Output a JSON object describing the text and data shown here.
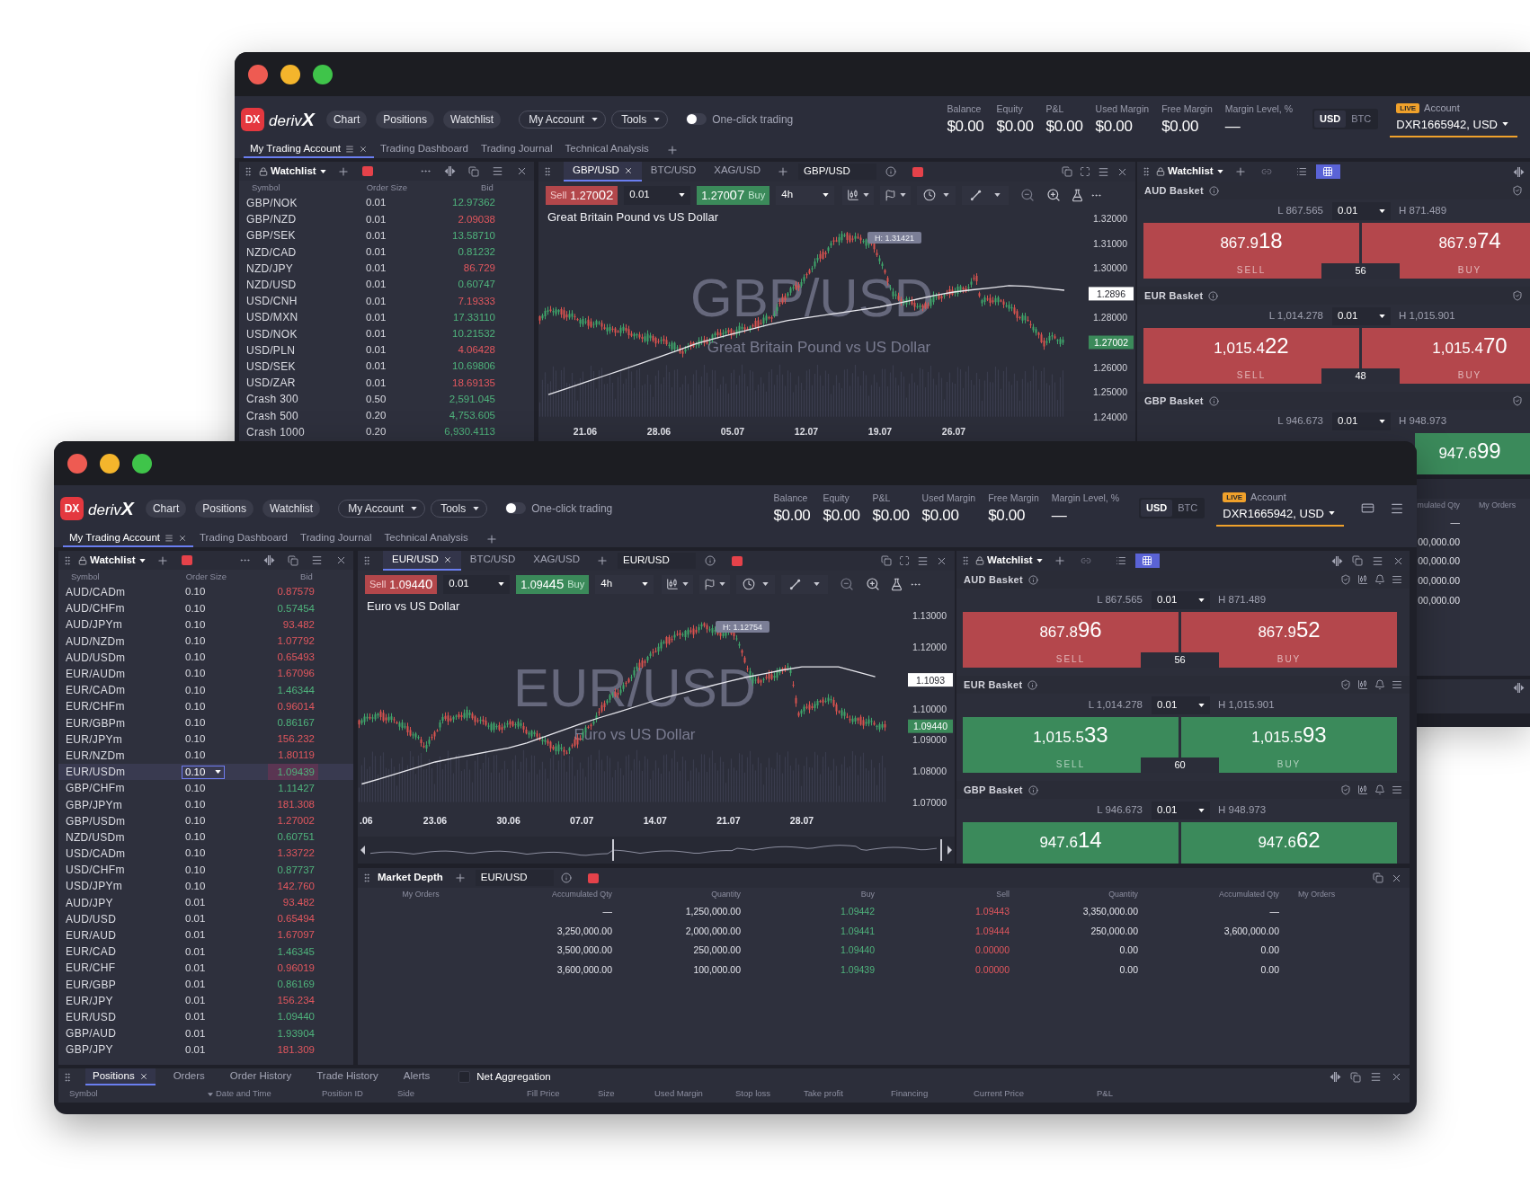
{
  "back_window": {
    "logo": {
      "badge": "DX",
      "wordmark": "deriv**X**"
    },
    "nav": [
      "Chart",
      "Positions",
      "Watchlist"
    ],
    "menus": [
      "My Account",
      "Tools"
    ],
    "one_click_trading": {
      "label": "One-click trading",
      "on": false
    },
    "metrics": [
      {
        "label": "Balance",
        "value": "$0.00"
      },
      {
        "label": "Equity",
        "value": "$0.00"
      },
      {
        "label": "P&L",
        "value": "$0.00"
      },
      {
        "label": "Used Margin",
        "value": "$0.00"
      },
      {
        "label": "Free Margin",
        "value": "$0.00"
      },
      {
        "label": "Margin Level, %",
        "value": "—"
      }
    ],
    "currencies": [
      {
        "label": "USD",
        "selected": true
      },
      {
        "label": "BTC",
        "selected": false
      }
    ],
    "account": {
      "badge": "LIVE",
      "label": "Account",
      "value": "DXR1665942, USD"
    },
    "workspace_tabs": [
      {
        "label": "My Trading Account",
        "selected": true
      },
      {
        "label": "Trading Dashboard",
        "selected": false
      },
      {
        "label": "Trading Journal",
        "selected": false
      },
      {
        "label": "Technical Analysis",
        "selected": false
      }
    ],
    "watchlist": {
      "title": "Watchlist",
      "columns": [
        "Symbol",
        "Order Size",
        "Bid"
      ],
      "rows": [
        {
          "symbol": "GBP/NOK",
          "order_size": "0.01",
          "bid": "12.97362",
          "rising": true,
          "selected": false
        },
        {
          "symbol": "GBP/NZD",
          "order_size": "0.01",
          "bid": "2.09038",
          "rising": false,
          "selected": false
        },
        {
          "symbol": "GBP/SEK",
          "order_size": "0.01",
          "bid": "13.58710",
          "rising": true,
          "selected": false
        },
        {
          "symbol": "NZD/CAD",
          "order_size": "0.01",
          "bid": "0.81232",
          "rising": true,
          "selected": false
        },
        {
          "symbol": "NZD/JPY",
          "order_size": "0.01",
          "bid": "86.729",
          "rising": false,
          "selected": false
        },
        {
          "symbol": "NZD/USD",
          "order_size": "0.01",
          "bid": "0.60747",
          "rising": true,
          "selected": false
        },
        {
          "symbol": "USD/CNH",
          "order_size": "0.01",
          "bid": "7.19333",
          "rising": false,
          "selected": false
        },
        {
          "symbol": "USD/MXN",
          "order_size": "0.01",
          "bid": "17.33110",
          "rising": true,
          "selected": false
        },
        {
          "symbol": "USD/NOK",
          "order_size": "0.01",
          "bid": "10.21532",
          "rising": true,
          "selected": false
        },
        {
          "symbol": "USD/PLN",
          "order_size": "0.01",
          "bid": "4.06428",
          "rising": false,
          "selected": false
        },
        {
          "symbol": "USD/SEK",
          "order_size": "0.01",
          "bid": "10.69806",
          "rising": true,
          "selected": false
        },
        {
          "symbol": "USD/ZAR",
          "order_size": "0.01",
          "bid": "18.69135",
          "rising": false,
          "selected": false
        },
        {
          "symbol": "Crash 300",
          "order_size": "0.50",
          "bid": "2,591.045",
          "rising": true,
          "selected": false
        },
        {
          "symbol": "Crash 500",
          "order_size": "0.20",
          "bid": "4,753.605",
          "rising": true,
          "selected": false
        },
        {
          "symbol": "Crash 1000",
          "order_size": "0.20",
          "bid": "6,930.4113",
          "rising": true,
          "selected": false
        }
      ]
    },
    "chart": {
      "tabs": [
        {
          "label": "GBP/USD",
          "selected": true
        },
        {
          "label": "BTC/USD",
          "selected": false
        },
        {
          "label": "XAG/USD",
          "selected": false
        }
      ],
      "symbol": "GBP/USD",
      "sell": {
        "label": "Sell",
        "price": "1.270**02**"
      },
      "order_size": "0.01",
      "buy": {
        "label": "Buy",
        "price": "1.270**07**"
      },
      "timeframe": "4h",
      "title": "Great Britain Pound vs US Dollar",
      "watermark": "GBP/USD",
      "watermark_subtitle": "Great Britain Pound vs US Dollar",
      "high_marker": "H: 1.31421",
      "price_tags": [
        {
          "value": "1.2896",
          "kind": "crosshair"
        },
        {
          "value": "1.27002",
          "kind": "last"
        }
      ],
      "chart_data": {
        "type": "line",
        "categories": [
          null,
          null,
          "21.06",
          null,
          null,
          null,
          "28.06",
          null,
          null,
          null,
          "05.07",
          null,
          null,
          null,
          "12.07",
          null,
          null,
          null,
          "19.07",
          null,
          null,
          null,
          "26.07",
          null,
          null,
          null,
          null,
          null,
          null
        ],
        "ylim": [
          1.24,
          1.32
        ],
        "yticks": [
          {
            "value": 1.32,
            "label": "1.32000"
          },
          {
            "value": 1.31,
            "label": "1.31000"
          },
          {
            "value": 1.3,
            "label": "1.30000"
          },
          {
            "value": 1.28,
            "label": "1.28000"
          },
          {
            "value": 1.26,
            "label": "1.26000"
          },
          {
            "value": 1.25,
            "label": "1.25000"
          },
          {
            "value": 1.24,
            "label": "1.24000"
          }
        ],
        "series": [
          {
            "color": "#e8e8ee",
            "values": [
              1.2489,
              1.2514,
              1.2539,
              1.2564,
              1.2589,
              1.2614,
              1.2641,
              1.2667,
              1.2694,
              1.2715,
              1.2734,
              1.2753,
              1.2772,
              1.2788,
              1.2799,
              1.281,
              1.2821,
              1.2832,
              1.2843,
              1.2858,
              1.2874,
              1.289,
              1.2903,
              1.2912,
              1.292,
              1.2929,
              1.2926,
              1.2918,
              1.291
            ]
          }
        ]
      }
    },
    "basket_watchlist": {
      "title": "Watchlist",
      "views": [
        {
          "kind": "list",
          "selected": false
        },
        {
          "kind": "grid",
          "selected": true
        }
      ],
      "baskets": [
        {
          "name": "AUD Basket",
          "low": "L 867.565",
          "order_size": "0.01",
          "high": "H 871.489",
          "rising": false,
          "sell": {
            "price": "867.9**18**",
            "label": "SELL"
          },
          "buy": {
            "price": "867.9**74**",
            "label": "BUY"
          },
          "spread": "56"
        },
        {
          "name": "EUR Basket",
          "low": "L 1,014.278",
          "order_size": "0.01",
          "high": "H 1,015.901",
          "rising": false,
          "sell": {
            "price": "1,015.4**22**",
            "label": "SELL"
          },
          "buy": {
            "price": "1,015.4**70**",
            "label": "BUY"
          },
          "spread": "48"
        },
        {
          "name": "GBP Basket",
          "low": "L 946.673",
          "order_size": "0.01",
          "high": "H 948.973",
          "rising": true,
          "buy": {
            "price": "947.6**99**"
          }
        }
      ]
    },
    "market_depth": {
      "columns": [
        "mulated Qty",
        "My Orders"
      ],
      "rows": [
        {
          "sell_accumulated_qty": "—"
        },
        {
          "sell_accumulated_qty": "00,000.00"
        },
        {
          "sell_accumulated_qty": "00,000.00"
        },
        {
          "sell_accumulated_qty": "00,000.00"
        },
        {
          "sell_accumulated_qty": "00,000.00"
        }
      ]
    }
  },
  "front_window": {
    "logo": {
      "badge": "DX",
      "wordmark": "deriv**X**"
    },
    "nav": [
      "Chart",
      "Positions",
      "Watchlist"
    ],
    "menus": [
      "My Account",
      "Tools"
    ],
    "one_click_trading": {
      "label": "One-click trading",
      "on": false
    },
    "metrics": [
      {
        "label": "Balance",
        "value": "$0.00"
      },
      {
        "label": "Equity",
        "value": "$0.00"
      },
      {
        "label": "P&L",
        "value": "$0.00"
      },
      {
        "label": "Used Margin",
        "value": "$0.00"
      },
      {
        "label": "Free Margin",
        "value": "$0.00"
      },
      {
        "label": "Margin Level, %",
        "value": "—"
      }
    ],
    "currencies": [
      {
        "label": "USD",
        "selected": true
      },
      {
        "label": "BTC",
        "selected": false
      }
    ],
    "account": {
      "badge": "LIVE",
      "label": "Account",
      "value": "DXR1665942, USD"
    },
    "workspace_tabs": [
      {
        "label": "My Trading Account",
        "selected": true
      },
      {
        "label": "Trading Dashboard",
        "selected": false
      },
      {
        "label": "Trading Journal",
        "selected": false
      },
      {
        "label": "Technical Analysis",
        "selected": false
      }
    ],
    "watchlist": {
      "title": "Watchlist",
      "columns": [
        "Symbol",
        "Order Size",
        "Bid"
      ],
      "rows": [
        {
          "symbol": "AUD/CADm",
          "order_size": "0.10",
          "bid": "0.87579",
          "rising": false,
          "selected": false
        },
        {
          "symbol": "AUD/CHFm",
          "order_size": "0.10",
          "bid": "0.57454",
          "rising": true,
          "selected": false
        },
        {
          "symbol": "AUD/JPYm",
          "order_size": "0.10",
          "bid": "93.482",
          "rising": false,
          "selected": false
        },
        {
          "symbol": "AUD/NZDm",
          "order_size": "0.10",
          "bid": "1.07792",
          "rising": false,
          "selected": false
        },
        {
          "symbol": "AUD/USDm",
          "order_size": "0.10",
          "bid": "0.65493",
          "rising": false,
          "selected": false
        },
        {
          "symbol": "EUR/AUDm",
          "order_size": "0.10",
          "bid": "1.67096",
          "rising": false,
          "selected": false
        },
        {
          "symbol": "EUR/CADm",
          "order_size": "0.10",
          "bid": "1.46344",
          "rising": true,
          "selected": false
        },
        {
          "symbol": "EUR/CHFm",
          "order_size": "0.10",
          "bid": "0.96014",
          "rising": false,
          "selected": false
        },
        {
          "symbol": "EUR/GBPm",
          "order_size": "0.10",
          "bid": "0.86167",
          "rising": true,
          "selected": false
        },
        {
          "symbol": "EUR/JPYm",
          "order_size": "0.10",
          "bid": "156.232",
          "rising": false,
          "selected": false
        },
        {
          "symbol": "EUR/NZDm",
          "order_size": "0.10",
          "bid": "1.80119",
          "rising": false,
          "selected": false
        },
        {
          "symbol": "EUR/USDm",
          "order_size": "0.10",
          "bid": "1.09439",
          "rising": true,
          "selected": true
        },
        {
          "symbol": "GBP/CHFm",
          "order_size": "0.10",
          "bid": "1.11427",
          "rising": true,
          "selected": false
        },
        {
          "symbol": "GBP/JPYm",
          "order_size": "0.10",
          "bid": "181.308",
          "rising": false,
          "selected": false
        },
        {
          "symbol": "GBP/USDm",
          "order_size": "0.10",
          "bid": "1.27002",
          "rising": false,
          "selected": false
        },
        {
          "symbol": "NZD/USDm",
          "order_size": "0.10",
          "bid": "0.60751",
          "rising": true,
          "selected": false
        },
        {
          "symbol": "USD/CADm",
          "order_size": "0.10",
          "bid": "1.33722",
          "rising": false,
          "selected": false
        },
        {
          "symbol": "USD/CHFm",
          "order_size": "0.10",
          "bid": "0.87737",
          "rising": true,
          "selected": false
        },
        {
          "symbol": "USD/JPYm",
          "order_size": "0.10",
          "bid": "142.760",
          "rising": false,
          "selected": false
        },
        {
          "symbol": "AUD/JPY",
          "order_size": "0.01",
          "bid": "93.482",
          "rising": false,
          "selected": false
        },
        {
          "symbol": "AUD/USD",
          "order_size": "0.01",
          "bid": "0.65494",
          "rising": false,
          "selected": false
        },
        {
          "symbol": "EUR/AUD",
          "order_size": "0.01",
          "bid": "1.67097",
          "rising": false,
          "selected": false
        },
        {
          "symbol": "EUR/CAD",
          "order_size": "0.01",
          "bid": "1.46345",
          "rising": true,
          "selected": false
        },
        {
          "symbol": "EUR/CHF",
          "order_size": "0.01",
          "bid": "0.96019",
          "rising": false,
          "selected": false
        },
        {
          "symbol": "EUR/GBP",
          "order_size": "0.01",
          "bid": "0.86169",
          "rising": true,
          "selected": false
        },
        {
          "symbol": "EUR/JPY",
          "order_size": "0.01",
          "bid": "156.234",
          "rising": false,
          "selected": false
        },
        {
          "symbol": "EUR/USD",
          "order_size": "0.01",
          "bid": "1.09440",
          "rising": true,
          "selected": false
        },
        {
          "symbol": "GBP/AUD",
          "order_size": "0.01",
          "bid": "1.93904",
          "rising": true,
          "selected": false
        },
        {
          "symbol": "GBP/JPY",
          "order_size": "0.01",
          "bid": "181.309",
          "rising": false,
          "selected": false
        }
      ]
    },
    "chart": {
      "tabs": [
        {
          "label": "EUR/USD",
          "selected": true
        },
        {
          "label": "BTC/USD",
          "selected": false
        },
        {
          "label": "XAG/USD",
          "selected": false
        }
      ],
      "symbol": "EUR/USD",
      "sell": {
        "label": "Sell",
        "price": "1.094**40**"
      },
      "order_size": "0.01",
      "buy": {
        "label": "Buy",
        "price": "1.094**45**"
      },
      "timeframe": "4h",
      "title": "Euro vs US Dollar",
      "watermark": "EUR/USD",
      "watermark_subtitle": "Euro vs US Dollar",
      "high_marker": "H: 1.12754",
      "price_tags": [
        {
          "value": "1.1093",
          "kind": "crosshair"
        },
        {
          "value": "1.09440",
          "kind": "last"
        }
      ],
      "chart_data": {
        "type": "line",
        "categories": [
          ".06",
          null,
          null,
          null,
          "23.06",
          null,
          null,
          null,
          "30.06",
          null,
          null,
          null,
          "07.07",
          null,
          null,
          null,
          "14.07",
          null,
          null,
          null,
          "21.07",
          null,
          null,
          null,
          "28.07",
          null,
          null,
          null,
          null
        ],
        "ylim": [
          1.07,
          1.13
        ],
        "yticks": [
          {
            "value": 1.13,
            "label": "1.13000"
          },
          {
            "value": 1.12,
            "label": "1.12000"
          },
          {
            "value": 1.1,
            "label": "1.10000"
          },
          {
            "value": 1.09,
            "label": "1.09000"
          },
          {
            "value": 1.08,
            "label": "1.08000"
          },
          {
            "value": 1.07,
            "label": "1.07000"
          }
        ],
        "series": [
          {
            "color": "#e8e8ee",
            "values": [
              1.0758,
              1.0775,
              1.0793,
              1.0811,
              1.0829,
              1.0841,
              1.0852,
              1.0863,
              1.0874,
              1.089,
              1.0911,
              1.0932,
              1.0953,
              1.0972,
              1.099,
              1.1008,
              1.1027,
              1.1043,
              1.1058,
              1.1073,
              1.1088,
              1.1102,
              1.1113,
              1.1125,
              1.1135,
              1.1135,
              1.1135,
              1.1119,
              1.1103
            ]
          }
        ]
      }
    },
    "basket_watchlist": {
      "title": "Watchlist",
      "views": [
        {
          "kind": "list",
          "selected": false
        },
        {
          "kind": "grid",
          "selected": true
        }
      ],
      "baskets": [
        {
          "name": "AUD Basket",
          "low": "L 867.565",
          "order_size": "0.01",
          "high": "H 871.489",
          "rising": false,
          "sell": {
            "price": "867.8**96**",
            "label": "SELL"
          },
          "buy": {
            "price": "867.9**52**",
            "label": "BUY"
          },
          "spread": "56"
        },
        {
          "name": "EUR Basket",
          "low": "L 1,014.278",
          "order_size": "0.01",
          "high": "H 1,015.901",
          "rising": true,
          "sell": {
            "price": "1,015.5**33**",
            "label": "SELL"
          },
          "buy": {
            "price": "1,015.5**93**",
            "label": "BUY"
          },
          "spread": "60"
        },
        {
          "name": "GBP Basket",
          "low": "L 946.673",
          "order_size": "0.01",
          "high": "H 948.973",
          "rising": true,
          "sell": {
            "price": "947.6**14**"
          },
          "buy": {
            "price": "947.6**62**"
          }
        }
      ]
    },
    "market_depth": {
      "title": "Market Depth",
      "symbol": "EUR/USD",
      "columns": [
        "My Orders",
        "Accumulated Qty",
        "Quantity",
        "Buy",
        "Sell",
        "Quantity",
        "Accumulated Qty",
        "My Orders"
      ],
      "rows": [
        {
          "buy_accumulated_qty": "—",
          "buy_quantity": "1,250,000.00",
          "buy": "1.09442",
          "sell": "1.09443",
          "sell_quantity": "3,350,000.00",
          "sell_accumulated_qty": "—"
        },
        {
          "buy_accumulated_qty": "3,250,000.00",
          "buy_quantity": "2,000,000.00",
          "buy": "1.09441",
          "sell": "1.09444",
          "sell_quantity": "250,000.00",
          "sell_accumulated_qty": "3,600,000.00"
        },
        {
          "buy_accumulated_qty": "3,500,000.00",
          "buy_quantity": "250,000.00",
          "buy": "1.09440",
          "sell": "0.00000",
          "sell_quantity": "0.00",
          "sell_accumulated_qty": "0.00"
        },
        {
          "buy_accumulated_qty": "3,600,000.00",
          "buy_quantity": "100,000.00",
          "buy": "1.09439",
          "sell": "0.00000",
          "sell_quantity": "0.00",
          "sell_accumulated_qty": "0.00"
        }
      ]
    },
    "positions": {
      "tabs": [
        {
          "label": "Positions",
          "selected": true
        },
        {
          "label": "Orders",
          "selected": false
        },
        {
          "label": "Order History",
          "selected": false
        },
        {
          "label": "Trade History",
          "selected": false
        },
        {
          "label": "Alerts",
          "selected": false
        }
      ],
      "net_aggregation": {
        "label": "Net Aggregation",
        "checked": false
      },
      "columns": [
        {
          "label": "Symbol",
          "sorted": false
        },
        {
          "label": "Date and Time",
          "sorted": true
        },
        {
          "label": "Position ID",
          "sorted": false
        },
        {
          "label": "Side",
          "sorted": false
        },
        {
          "label": "Fill Price",
          "sorted": false
        },
        {
          "label": "Size",
          "sorted": false
        },
        {
          "label": "Used Margin",
          "sorted": false
        },
        {
          "label": "Stop loss",
          "sorted": false
        },
        {
          "label": "Take profit",
          "sorted": false
        },
        {
          "label": "Financing",
          "sorted": false
        },
        {
          "label": "Current Price",
          "sorted": false
        },
        {
          "label": "P&L",
          "sorted": false
        }
      ]
    }
  }
}
